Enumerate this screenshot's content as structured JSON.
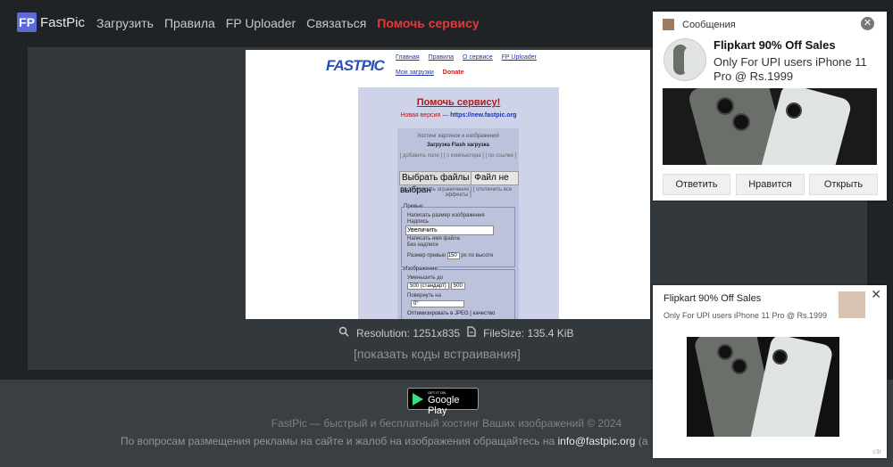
{
  "header": {
    "logo_mark": "FP",
    "logo_text": "FastPic",
    "nav": [
      "Загрузить",
      "Правила",
      "FP Uploader",
      "Связаться",
      "Помочь сервису"
    ]
  },
  "preview": {
    "logo": "FASTPIC",
    "links_row1": [
      "Главная",
      "Правила",
      "О сервисе",
      "FP Uploader"
    ],
    "links_row2": [
      "Мои загрузки"
    ],
    "donate": "Donate",
    "help_title": "Помочь сервису!",
    "new_version_label": "Новая версия —",
    "new_version_url": "https://new.fastpic.org",
    "box_title": "Хостинг картинок и изображений",
    "upload_tabs": "Загрузка Flash загрузка",
    "add_field": "[ добавить поле ] [ с компьютера ] [ по ссылке ]",
    "choose_files": "Выбрать файлы",
    "no_file": "Файл не выбран",
    "limits": "[ посмотреть ограничения ] [ отключить все эффекты ]",
    "preview_legend": "Превью",
    "opt_size": "Нaписать размер изображения",
    "opt_caption": "Надпись",
    "caption_value": "Увеличить",
    "opt_filename": "Написать имя файла",
    "opt_none": "Без надписи",
    "preview_size_label": "Размер превью",
    "preview_size_value": "150",
    "preview_size_unit": "px",
    "by_height": "по высоте",
    "image_legend": "Изображение",
    "reduce_to": "Уменьшить до",
    "reduce_select": "500 (стандарт)",
    "reduce_value": "500",
    "rotate": "Повернуть на",
    "rotate_value": "0°",
    "optimize": "Оптимизировать в JPEG [ качество"
  },
  "stats": {
    "resolution": "Resolution: 1251x835",
    "filesize": "FileSize: 135.4 KiB"
  },
  "embed_link": "[показать коды встраивания]",
  "footer": {
    "gplay_small": "GET IT ON",
    "gplay_big": "Google Play",
    "line1": "FastPic — быстрый и бесплатный хостинг Ваших изображений © 2024",
    "line2_prefix": "По вопросам размещения рекламы на сайте и жалоб на изображения обращайтесь на",
    "line2_email": "info@fastpic.org",
    "line2_suffix": "(а"
  },
  "notification": {
    "source": "Сообщения",
    "title": "Flipkart 90% Off Sales",
    "body": "Only For UPI users iPhone 11 Pro @ Rs.1999",
    "buttons": [
      "Ответить",
      "Нравится",
      "Открыть"
    ]
  },
  "ad": {
    "title": "Flipkart 90% Off Sales",
    "body": "Only For UPI users iPhone 11 Pro @ Rs.1999",
    "mark": "c3r"
  },
  "colors": {
    "page_bg": "#202326",
    "viewer_bg": "#33383c",
    "accent_red": "#e23a3a",
    "logo_blue": "#5b6ad6"
  }
}
